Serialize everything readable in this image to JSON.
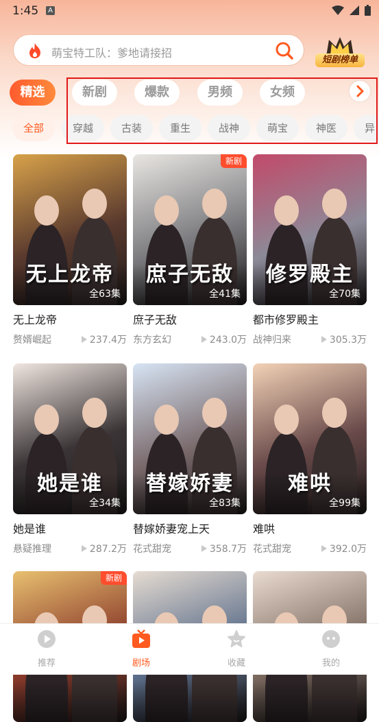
{
  "status_bar": {
    "time": "1:45",
    "notification_letter": "A"
  },
  "search": {
    "placeholder": "萌宝特工队：爹地请接招"
  },
  "rank_badge": {
    "label": "短剧榜单"
  },
  "tabs": [
    {
      "label": "精选",
      "selected": true
    },
    {
      "label": "新剧"
    },
    {
      "label": "爆款"
    },
    {
      "label": "男频"
    },
    {
      "label": "女频"
    }
  ],
  "categories": [
    {
      "label": "全部",
      "selected": true
    },
    {
      "label": "穿越"
    },
    {
      "label": "古装"
    },
    {
      "label": "重生"
    },
    {
      "label": "战神"
    },
    {
      "label": "萌宝"
    },
    {
      "label": "神医"
    },
    {
      "label": "异"
    }
  ],
  "dramas": [
    {
      "title": "无上龙帝",
      "poster_text": "无上龙帝",
      "episodes": "全63集",
      "genre": "赘婿崛起",
      "views": "237.4万",
      "new_tag": "",
      "bg": "#5a3a2e",
      "accent": "#d8a24a"
    },
    {
      "title": "庶子无敌",
      "poster_text": "庶子无敌",
      "episodes": "全41集",
      "genre": "东方玄幻",
      "views": "243.0万",
      "new_tag": "新剧",
      "bg": "#7c7c80",
      "accent": "#e9e6e2"
    },
    {
      "title": "都市修罗殿主",
      "poster_text": "修罗殿主",
      "episodes": "全70集",
      "genre": "战神归来",
      "views": "305.3万",
      "new_tag": "",
      "bg": "#8c8a98",
      "accent": "#c24a6a"
    },
    {
      "title": "她是谁",
      "poster_text": "她是谁",
      "episodes": "全34集",
      "genre": "悬疑推理",
      "views": "287.2万",
      "new_tag": "",
      "bg": "#3a3436",
      "accent": "#f0e6e0"
    },
    {
      "title": "替嫁娇妻宠上天",
      "poster_text": "替嫁娇妻",
      "episodes": "全83集",
      "genre": "花式甜宠",
      "views": "358.7万",
      "new_tag": "",
      "bg": "#7a6a6c",
      "accent": "#d7e4f4"
    },
    {
      "title": "难哄",
      "poster_text": "难哄",
      "episodes": "全99集",
      "genre": "花式甜宠",
      "views": "392.0万",
      "new_tag": "",
      "bg": "#6a4a4a",
      "accent": "#f2d2b6"
    },
    {
      "title": "",
      "poster_text": "",
      "episodes": "",
      "genre": "",
      "views": "",
      "new_tag": "新剧",
      "bg": "#8a3a2a",
      "accent": "#e8c070"
    },
    {
      "title": "",
      "poster_text": "",
      "episodes": "",
      "genre": "",
      "views": "",
      "new_tag": "",
      "bg": "#5c6e8a",
      "accent": "#e6dcd2"
    },
    {
      "title": "",
      "poster_text": "",
      "episodes": "",
      "genre": "",
      "views": "",
      "new_tag": "",
      "bg": "#7c6a60",
      "accent": "#eadbd0"
    }
  ],
  "bottom_nav": [
    {
      "label": "推荐",
      "icon": "play-circle-icon"
    },
    {
      "label": "剧场",
      "icon": "tv-icon",
      "selected": true
    },
    {
      "label": "收藏",
      "icon": "star-icon"
    },
    {
      "label": "我的",
      "icon": "profile-face-icon"
    }
  ],
  "colors": {
    "accent": "#ff5a1f",
    "highlight_box": "#e01818"
  }
}
